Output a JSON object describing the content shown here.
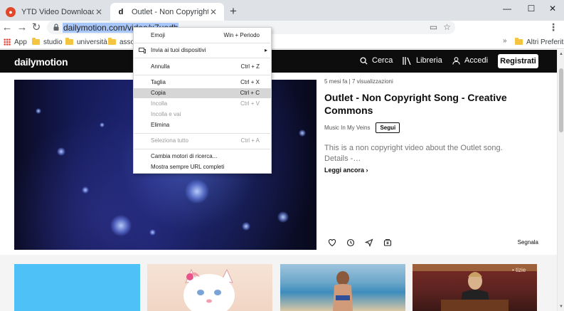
{
  "tabs": [
    {
      "title": "YTD Video Downloader - Free video",
      "icon": "ytd-icon",
      "close": "✕"
    },
    {
      "title": "Outlet - Non Copyright Song - C",
      "icon": "d",
      "close": "✕"
    }
  ],
  "new_tab": "+",
  "window": {
    "minimize": "—",
    "maximize": "☐",
    "close": "✕"
  },
  "toolbar": {
    "back": "←",
    "forward": "→",
    "reload": "↻",
    "url": "dailymotion.com/video/x7uedh",
    "menu": "⋮"
  },
  "bookmarks": {
    "apps": "App",
    "items": [
      "studio",
      "università",
      "associ"
    ],
    "overflow": "»",
    "other": "Altri Preferiti"
  },
  "site": {
    "logo": "dailymotion",
    "nav": {
      "search": "Cerca",
      "library": "Libreria",
      "login": "Accedi",
      "signup": "Registrati"
    }
  },
  "video": {
    "meta": "5 mesi fa  |  7 visualizzazioni",
    "title": "Outlet - Non Copyright Song - Creative Commons",
    "channel": "Music In My Veins",
    "follow": "Segui",
    "description": "This is a non copyright video about the Outlet song. Details -…",
    "read_more": "Leggi ancora ›",
    "report": "Segnala"
  },
  "context_menu": {
    "items": [
      {
        "label": "Emoji",
        "shortcut": "Win + Periodo",
        "disabled": false
      },
      {
        "label": "Invia ai tuoi dispositivi",
        "shortcut": "",
        "arrow": "▸",
        "disabled": false
      },
      {
        "label": "Annulla",
        "shortcut": "Ctrl + Z",
        "disabled": false
      },
      {
        "label": "Taglia",
        "shortcut": "Ctrl + X",
        "disabled": false
      },
      {
        "label": "Copia",
        "shortcut": "Ctrl + C",
        "disabled": false
      },
      {
        "label": "Incolla",
        "shortcut": "Ctrl + V",
        "disabled": true
      },
      {
        "label": "Incolla e vai",
        "shortcut": "",
        "disabled": true
      },
      {
        "label": "Elimina",
        "shortcut": "",
        "disabled": false
      },
      {
        "label": "Seleziona tutto",
        "shortcut": "Ctrl + A",
        "disabled": true
      },
      {
        "label": "Cambia motori di ricerca...",
        "shortcut": "",
        "disabled": false
      },
      {
        "label": "Mostra sempre URL completi",
        "shortcut": "",
        "disabled": false
      }
    ]
  },
  "thumbnails": {
    "badge": "• tizie"
  },
  "colors": {
    "dm_header": "#0d0d0d",
    "selection": "#a8c7fa",
    "highlight": "#d6d6d6"
  }
}
